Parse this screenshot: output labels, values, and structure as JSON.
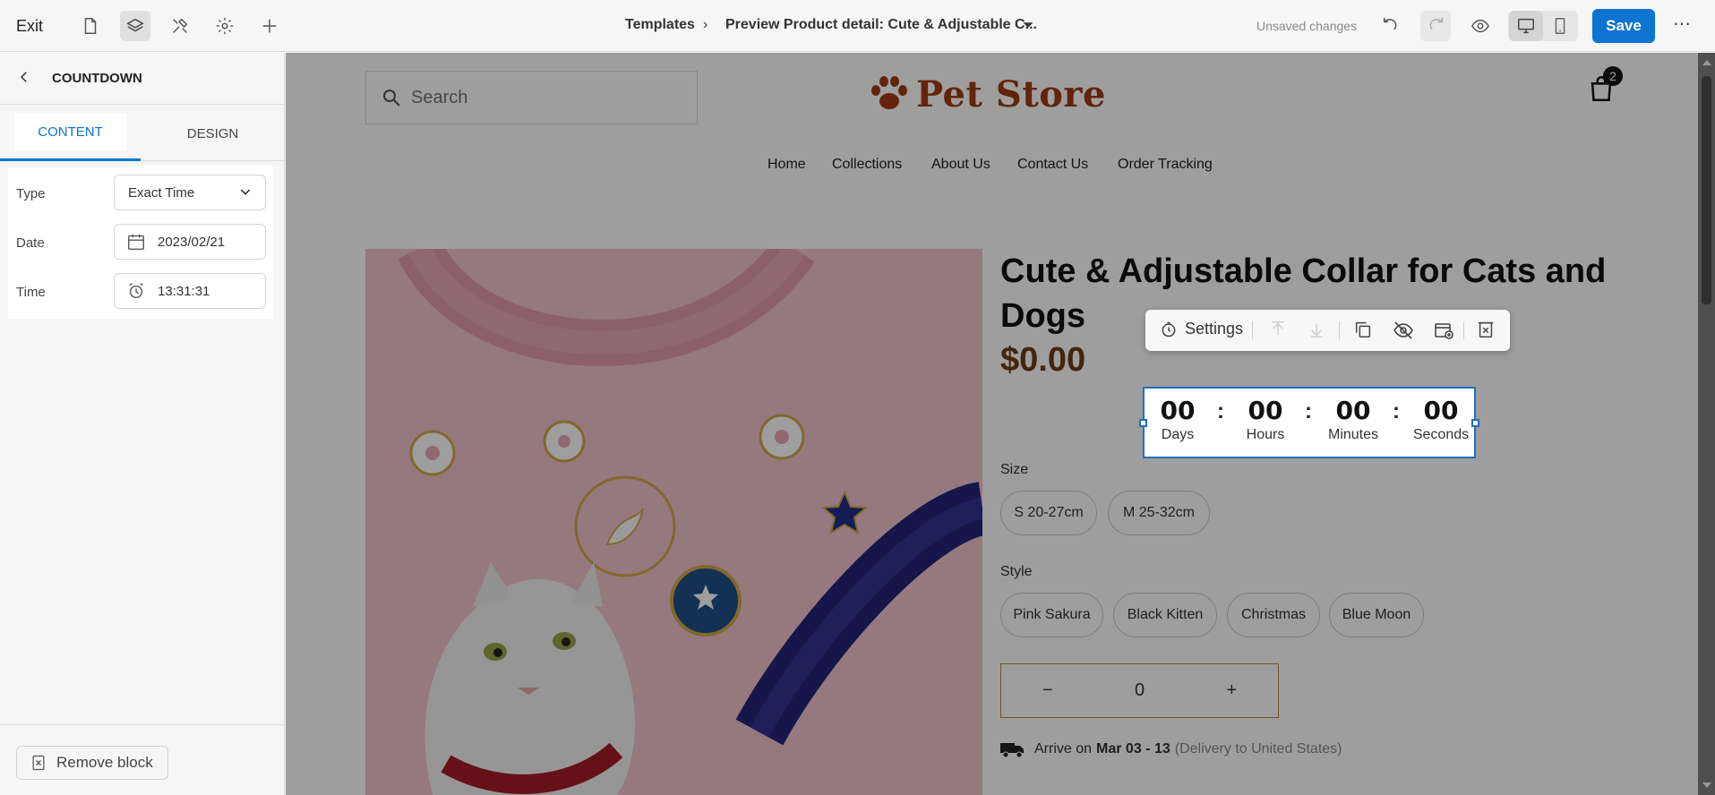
{
  "topbar": {
    "exit_label": "Exit",
    "breadcrumb_root": "Templates",
    "breadcrumb_current": "Preview Product detail: Cute & Adjustable C...",
    "unsaved": "Unsaved changes",
    "save_label": "Save",
    "more_label": "⋯",
    "icons": [
      "page-icon",
      "layers-icon",
      "tools-icon",
      "gear-icon",
      "plus-icon",
      "undo-icon",
      "redo-icon",
      "eye-icon",
      "desktop-icon",
      "mobile-icon"
    ]
  },
  "sidebar": {
    "title": "COUNTDOWN",
    "tabs": {
      "content": "CONTENT",
      "design": "DESIGN"
    },
    "fields": {
      "type": {
        "label": "Type",
        "value": "Exact Time"
      },
      "date": {
        "label": "Date",
        "value": "2023/02/21"
      },
      "time": {
        "label": "Time",
        "value": "13:31:31"
      }
    },
    "remove_label": "Remove block"
  },
  "store": {
    "search_placeholder": "Search",
    "logo_text": "Pet Store",
    "cart_count": "2",
    "nav": [
      "Home",
      "Collections",
      "About Us",
      "Contact Us",
      "Order Tracking"
    ],
    "product": {
      "title": "Cute & Adjustable Collar for Cats and Dogs",
      "price": "$0.00",
      "size_label": "Size",
      "sizes": [
        "S 20-27cm",
        "M 25-32cm"
      ],
      "style_label": "Style",
      "styles": [
        "Pink Sakura",
        "Black Kitten",
        "Christmas",
        "Blue Moon"
      ],
      "qty_minus": "−",
      "qty_value": "0",
      "qty_plus": "+",
      "arrive_prefix": "Arrive on",
      "arrive_dates": "Mar 03 - 13",
      "arrive_dest": "(Delivery to United States)"
    }
  },
  "floating_toolbar": {
    "settings_label": "Settings"
  },
  "countdown": {
    "days": "00",
    "hours": "00",
    "minutes": "00",
    "seconds": "00",
    "days_label": "Days",
    "hours_label": "Hours",
    "minutes_label": "Minutes",
    "seconds_label": "Seconds",
    "separator": ":"
  },
  "colors": {
    "accent": "#0d74d1",
    "brand": "#a13a12",
    "price": "#6e3d12",
    "selection": "#1f6fc1"
  }
}
